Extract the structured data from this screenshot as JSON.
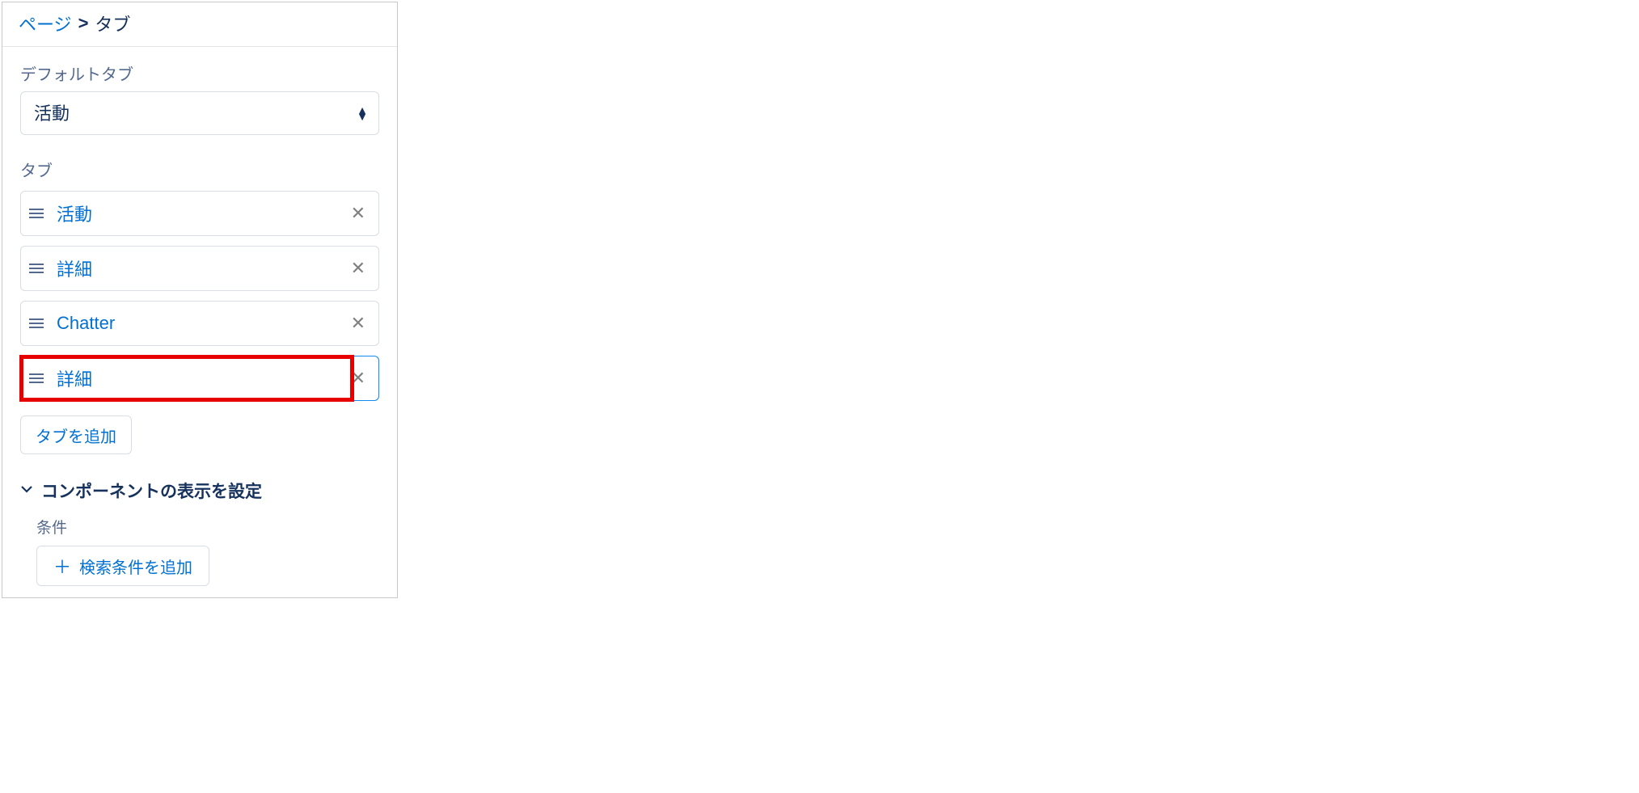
{
  "breadcrumb": {
    "parent": "ページ",
    "separator": ">",
    "current": "タブ"
  },
  "defaultTab": {
    "label": "デフォルトタブ",
    "value": "活動"
  },
  "tabs": {
    "label": "タブ",
    "items": [
      {
        "label": "活動",
        "selected": false,
        "highlighted": false
      },
      {
        "label": "詳細",
        "selected": false,
        "highlighted": false
      },
      {
        "label": "Chatter",
        "selected": false,
        "highlighted": false
      },
      {
        "label": "詳細",
        "selected": true,
        "highlighted": true
      }
    ],
    "addButton": "タブを追加"
  },
  "visibility": {
    "title": "コンポーネントの表示を設定",
    "conditionLabel": "条件",
    "addCondition": "検索条件を追加"
  }
}
